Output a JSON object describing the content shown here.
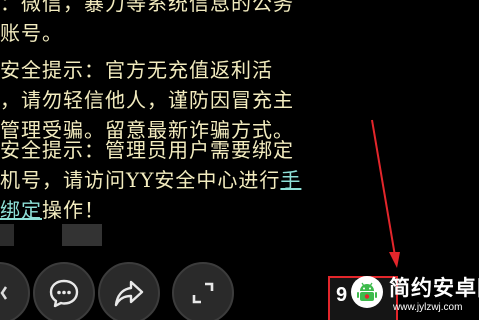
{
  "messages": {
    "top": {
      "line1": "：微信，暴力等系统信息的公务",
      "line2": "账号。"
    },
    "tip1": {
      "line1": "安全提示：官方无充值返利活",
      "line2": "，请勿轻信他人，谨防因冒充主",
      "line3": "管理受骗。留意最新诈骗方式。"
    },
    "tip2": {
      "line1": "安全提示：管理员用户需要绑定",
      "line2_prefix": "机号，请访问YY安全中心进行",
      "line2_link": "手",
      "line3_link": "绑定",
      "line3_suffix": "操作！"
    }
  },
  "annotation": {
    "box_text": "9",
    "color": "#e3262b"
  },
  "watermark": {
    "title": "简约安卓网",
    "url": "www.jylzwj.com"
  },
  "colors": {
    "message_text": "#f3ecbf",
    "link_text": "#8ee0d7",
    "annotation_red": "#e3262b",
    "button_bg": "#2a2a2a",
    "watermark_green": "#3dbb4c"
  },
  "icons": {
    "partial_button": "partial-circle-icon",
    "chat": "chat-bubble-icon",
    "share": "share-arrow-icon",
    "fullscreen": "fullscreen-corners-icon",
    "watermark_logo": "android-robot-icon"
  }
}
